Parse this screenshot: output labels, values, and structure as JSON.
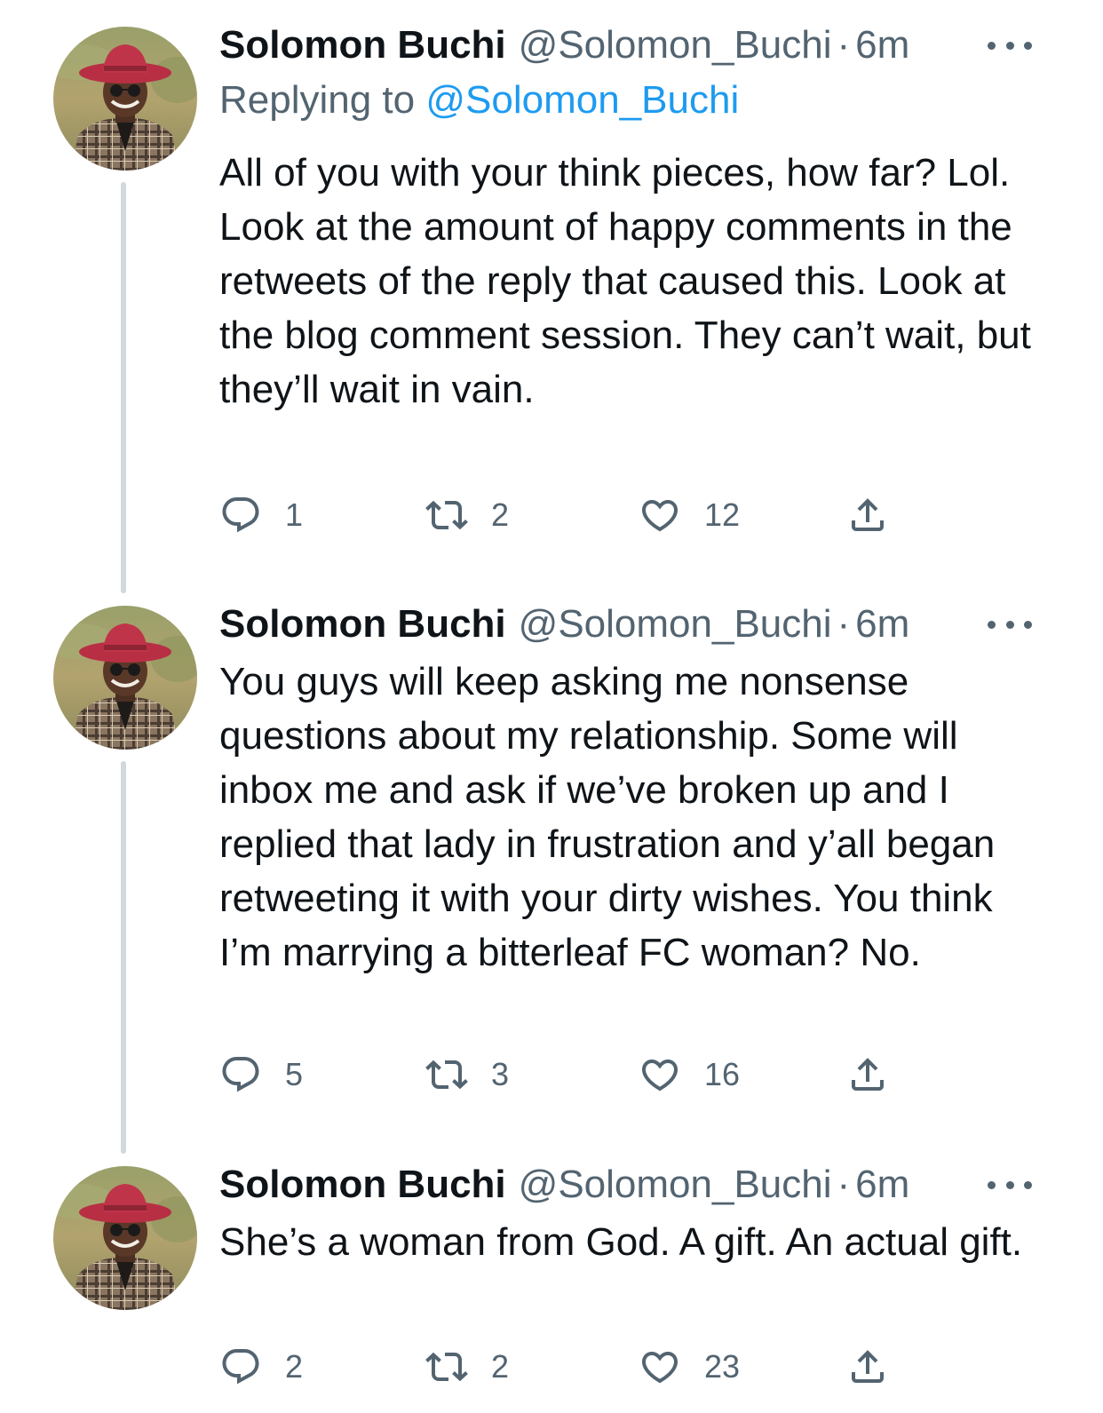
{
  "tweets": [
    {
      "name": "Solomon Buchi",
      "handle": "@Solomon_Buchi",
      "separator": "·",
      "time": "6m",
      "replying_prefix": "Replying to",
      "replying_handle": "@Solomon_Buchi",
      "text": "All of you with your think pieces, how far? Lol. Look at the amount of happy comments in the retweets of the reply that caused this. Look at the blog comment session. They can’t wait, but they’ll wait in vain.",
      "replies": "1",
      "retweets": "2",
      "likes": "12"
    },
    {
      "name": "Solomon Buchi",
      "handle": "@Solomon_Buchi",
      "separator": "·",
      "time": "6m",
      "text": "You guys will keep asking me nonsense questions about my relationship. Some will inbox me and ask if we’ve broken up and I replied that lady in frustration and y’all began retweeting it with your dirty wishes. You think I’m marrying a bitterleaf FC woman? No.",
      "replies": "5",
      "retweets": "3",
      "likes": "16"
    },
    {
      "name": "Solomon Buchi",
      "handle": "@Solomon_Buchi",
      "separator": "·",
      "time": "6m",
      "text": "She’s a woman from God. A gift. An actual gift.",
      "replies": "2",
      "retweets": "2",
      "likes": "23"
    }
  ],
  "icons": {
    "reply": "reply-icon",
    "retweet": "retweet-icon",
    "like": "heart-icon",
    "share": "share-icon",
    "more": "more-icon"
  },
  "colors": {
    "text": "#0f1419",
    "secondary": "#536471",
    "link": "#1d9bf0",
    "thread_line": "#cfd9de",
    "hat": "#c0344a"
  }
}
